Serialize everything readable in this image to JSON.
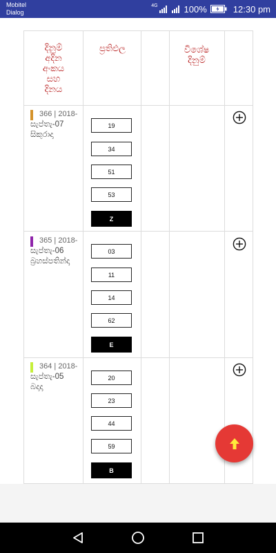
{
  "status_bar": {
    "carrier_line1": "Mobitel",
    "carrier_line2": "Dialog",
    "network": "4G",
    "battery": "100%",
    "time": "12:30 pm"
  },
  "table": {
    "headers": [
      "දිනුම් අදින අංකය සහ දිනය",
      "ප්‍රතිඵල",
      "",
      "විශේෂ දිනුම්",
      ""
    ],
    "header_lines": {
      "col1": [
        "දිනුම්",
        "අදින",
        "අංකය",
        "සහ",
        "දිනය"
      ],
      "col2": [
        "ප්‍රතිඵල"
      ],
      "col4": [
        "විශේෂ",
        "දිනුම්"
      ]
    },
    "rows": [
      {
        "draw": "366 | 2018-",
        "date": "සැප්තැ-07",
        "day": "සිකුරාදා",
        "color": "#d4922a",
        "numbers": [
          "19",
          "34",
          "51",
          "53"
        ],
        "letter": "Z"
      },
      {
        "draw": "365 | 2018-",
        "date": "සැප්තැ-06",
        "day": "බ්‍රහස්පතින්දා",
        "color": "#8e24aa",
        "numbers": [
          "03",
          "11",
          "14",
          "62"
        ],
        "letter": "E"
      },
      {
        "draw": "364 | 2018-",
        "date": "සැප්තැ-05",
        "day": "බදාදා",
        "color": "#c6ef3a",
        "numbers": [
          "20",
          "23",
          "44",
          "59"
        ],
        "letter": "B"
      }
    ]
  },
  "icons": {
    "add": "plus-circle-icon",
    "fab": "arrow-up-icon",
    "nav": [
      "back-icon",
      "home-icon",
      "recents-icon"
    ]
  },
  "colors": {
    "status_bar": "#303F9F",
    "header_text": "#b71c1c",
    "fab": "#e53935",
    "fab_arrow": "#ffeb3b"
  }
}
